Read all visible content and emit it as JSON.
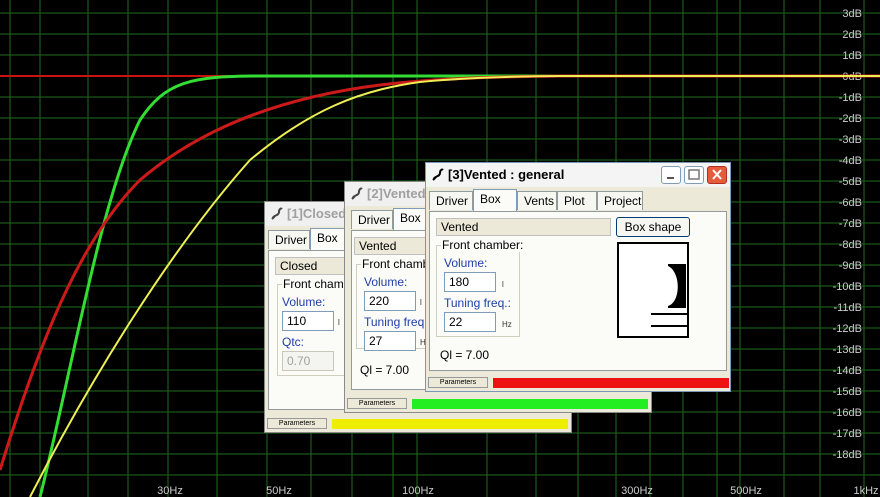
{
  "graph": {
    "db_labels": [
      "3dB",
      "2dB",
      "1dB",
      "0dB",
      "-1dB",
      "-2dB",
      "-3dB",
      "-4dB",
      "-5dB",
      "-6dB",
      "-7dB",
      "-8dB",
      "-9dB",
      "-10dB",
      "-11dB",
      "-12dB",
      "-13dB",
      "-14dB",
      "-15dB",
      "-16dB",
      "-17dB",
      "-18dB"
    ],
    "freq_labels": [
      "30Hz",
      "50Hz",
      "100Hz",
      "300Hz",
      "500Hz",
      "1kHz"
    ],
    "colors": {
      "background": "#000000",
      "grid": "#1f6b1f",
      "zero_line": "#cc1111",
      "green": "#33dd33",
      "red": "#cc1a1a",
      "yellow": "#eeee55"
    }
  },
  "windows": {
    "closed": {
      "title": "[1]Closed",
      "tabs": [
        "Driver",
        "Box"
      ],
      "type_value": "Closed",
      "group_label": "Front chamber",
      "volume_label": "Volume:",
      "volume_value": "110",
      "volume_unit": "l",
      "qtc_label": "Qtc:",
      "qtc_value": "0.70",
      "status_label": "Parameters",
      "status_color": "#eeee00"
    },
    "vented2": {
      "title": "[2]Vented",
      "tabs": [
        "Driver",
        "Box"
      ],
      "type_value": "Vented",
      "group_label": "Front chamber:",
      "volume_label": "Volume:",
      "volume_value": "220",
      "volume_unit": "l",
      "tuning_label": "Tuning freq.:",
      "tuning_value": "27",
      "tuning_unit": "Hz",
      "ql_text": "Ql = 7.00",
      "status_label": "Parameters",
      "status_color": "#22ee22"
    },
    "vented3": {
      "title": "[3]Vented : general",
      "tabs": [
        "Driver",
        "Box",
        "Vents",
        "Plot",
        "Project"
      ],
      "type_value": "Vented",
      "box_shape_label": "Box shape",
      "group_label": "Front chamber:",
      "volume_label": "Volume:",
      "volume_value": "180",
      "volume_unit": "l",
      "tuning_label": "Tuning freq.:",
      "tuning_value": "22",
      "tuning_unit": "Hz",
      "ql_text": "Ql = 7.00",
      "status_label": "Parameters",
      "status_color": "#ee1111"
    }
  }
}
